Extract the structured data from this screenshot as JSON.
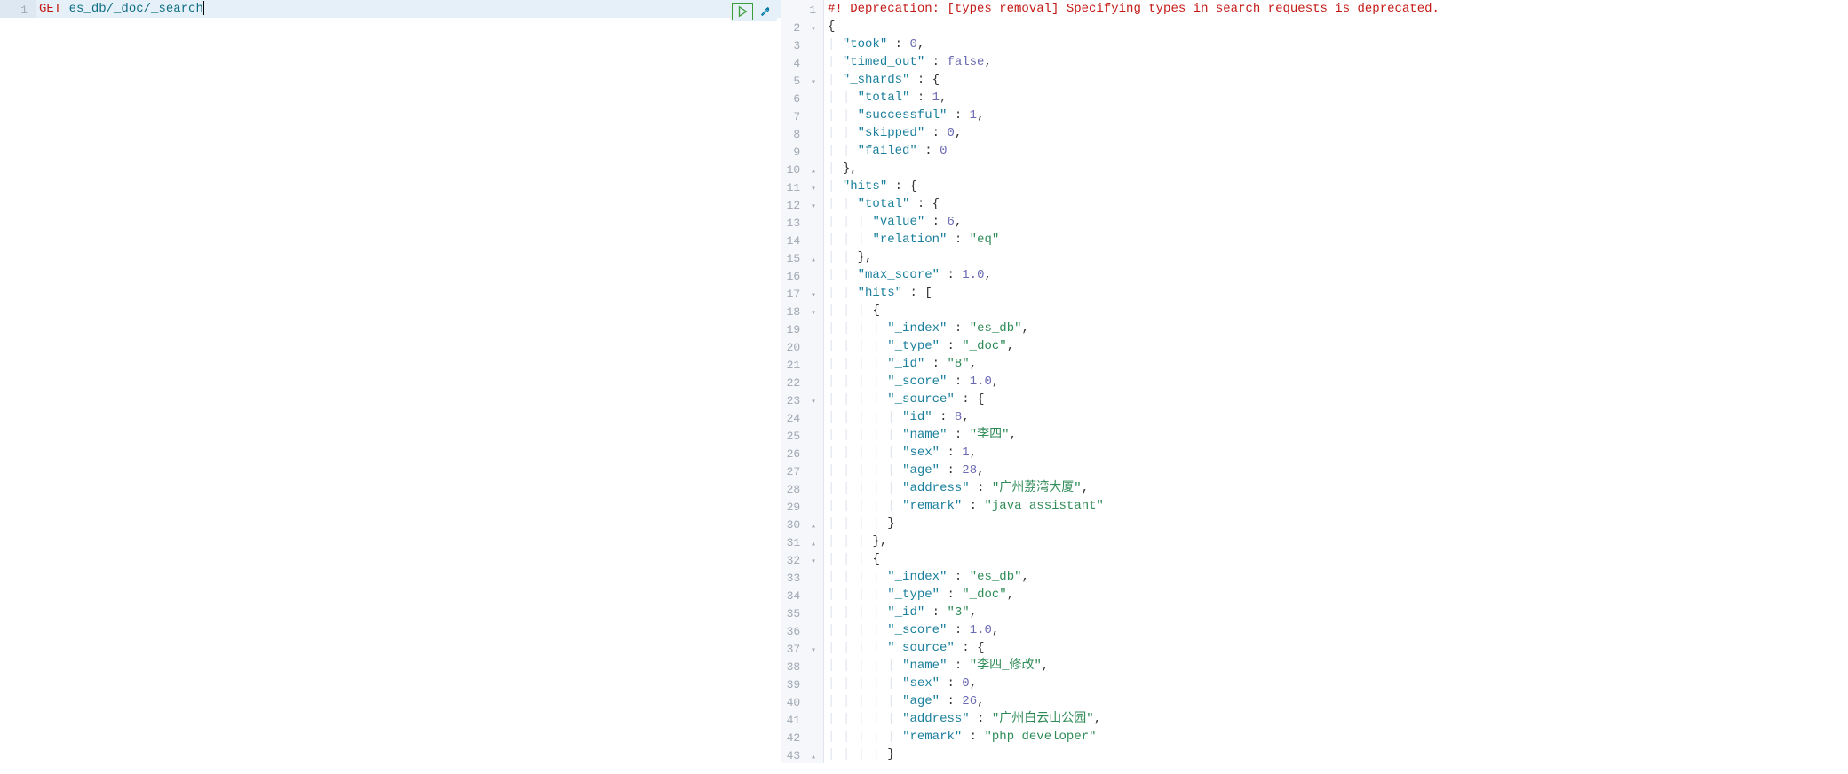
{
  "request": {
    "line_number": "1",
    "method": "GET",
    "path": "es_db/_doc/_search"
  },
  "actions": {
    "play": "play",
    "wrench": "wrench"
  },
  "response": {
    "deprecation_prefix": "#!",
    "deprecation_msg": "Deprecation: [types removal] Specifying types in search requests is deprecated.",
    "lines": [
      {
        "n": "1",
        "fold": "",
        "code": ""
      },
      {
        "n": "2",
        "fold": "▾",
        "indent": 0,
        "tokens": [
          {
            "t": "punct",
            "v": "{"
          }
        ]
      },
      {
        "n": "3",
        "fold": "",
        "indent": 1,
        "tokens": [
          {
            "t": "key",
            "v": "\"took\""
          },
          {
            "t": "punct",
            "v": " : "
          },
          {
            "t": "num",
            "v": "0"
          },
          {
            "t": "punct",
            "v": ","
          }
        ]
      },
      {
        "n": "4",
        "fold": "",
        "indent": 1,
        "tokens": [
          {
            "t": "key",
            "v": "\"timed_out\""
          },
          {
            "t": "punct",
            "v": " : "
          },
          {
            "t": "bool",
            "v": "false"
          },
          {
            "t": "punct",
            "v": ","
          }
        ]
      },
      {
        "n": "5",
        "fold": "▾",
        "indent": 1,
        "tokens": [
          {
            "t": "key",
            "v": "\"_shards\""
          },
          {
            "t": "punct",
            "v": " : {"
          }
        ]
      },
      {
        "n": "6",
        "fold": "",
        "indent": 2,
        "tokens": [
          {
            "t": "key",
            "v": "\"total\""
          },
          {
            "t": "punct",
            "v": " : "
          },
          {
            "t": "num",
            "v": "1"
          },
          {
            "t": "punct",
            "v": ","
          }
        ]
      },
      {
        "n": "7",
        "fold": "",
        "indent": 2,
        "tokens": [
          {
            "t": "key",
            "v": "\"successful\""
          },
          {
            "t": "punct",
            "v": " : "
          },
          {
            "t": "num",
            "v": "1"
          },
          {
            "t": "punct",
            "v": ","
          }
        ]
      },
      {
        "n": "8",
        "fold": "",
        "indent": 2,
        "tokens": [
          {
            "t": "key",
            "v": "\"skipped\""
          },
          {
            "t": "punct",
            "v": " : "
          },
          {
            "t": "num",
            "v": "0"
          },
          {
            "t": "punct",
            "v": ","
          }
        ]
      },
      {
        "n": "9",
        "fold": "",
        "indent": 2,
        "tokens": [
          {
            "t": "key",
            "v": "\"failed\""
          },
          {
            "t": "punct",
            "v": " : "
          },
          {
            "t": "num",
            "v": "0"
          }
        ]
      },
      {
        "n": "10",
        "fold": "▴",
        "indent": 1,
        "tokens": [
          {
            "t": "punct",
            "v": "},"
          }
        ]
      },
      {
        "n": "11",
        "fold": "▾",
        "indent": 1,
        "tokens": [
          {
            "t": "key",
            "v": "\"hits\""
          },
          {
            "t": "punct",
            "v": " : {"
          }
        ]
      },
      {
        "n": "12",
        "fold": "▾",
        "indent": 2,
        "tokens": [
          {
            "t": "key",
            "v": "\"total\""
          },
          {
            "t": "punct",
            "v": " : {"
          }
        ]
      },
      {
        "n": "13",
        "fold": "",
        "indent": 3,
        "tokens": [
          {
            "t": "key",
            "v": "\"value\""
          },
          {
            "t": "punct",
            "v": " : "
          },
          {
            "t": "num",
            "v": "6"
          },
          {
            "t": "punct",
            "v": ","
          }
        ]
      },
      {
        "n": "14",
        "fold": "",
        "indent": 3,
        "tokens": [
          {
            "t": "key",
            "v": "\"relation\""
          },
          {
            "t": "punct",
            "v": " : "
          },
          {
            "t": "str",
            "v": "\"eq\""
          }
        ]
      },
      {
        "n": "15",
        "fold": "▴",
        "indent": 2,
        "tokens": [
          {
            "t": "punct",
            "v": "},"
          }
        ]
      },
      {
        "n": "16",
        "fold": "",
        "indent": 2,
        "tokens": [
          {
            "t": "key",
            "v": "\"max_score\""
          },
          {
            "t": "punct",
            "v": " : "
          },
          {
            "t": "num",
            "v": "1.0"
          },
          {
            "t": "punct",
            "v": ","
          }
        ]
      },
      {
        "n": "17",
        "fold": "▾",
        "indent": 2,
        "tokens": [
          {
            "t": "key",
            "v": "\"hits\""
          },
          {
            "t": "punct",
            "v": " : ["
          }
        ]
      },
      {
        "n": "18",
        "fold": "▾",
        "indent": 3,
        "tokens": [
          {
            "t": "punct",
            "v": "{"
          }
        ]
      },
      {
        "n": "19",
        "fold": "",
        "indent": 4,
        "tokens": [
          {
            "t": "key",
            "v": "\"_index\""
          },
          {
            "t": "punct",
            "v": " : "
          },
          {
            "t": "str",
            "v": "\"es_db\""
          },
          {
            "t": "punct",
            "v": ","
          }
        ]
      },
      {
        "n": "20",
        "fold": "",
        "indent": 4,
        "tokens": [
          {
            "t": "key",
            "v": "\"_type\""
          },
          {
            "t": "punct",
            "v": " : "
          },
          {
            "t": "str",
            "v": "\"_doc\""
          },
          {
            "t": "punct",
            "v": ","
          }
        ]
      },
      {
        "n": "21",
        "fold": "",
        "indent": 4,
        "tokens": [
          {
            "t": "key",
            "v": "\"_id\""
          },
          {
            "t": "punct",
            "v": " : "
          },
          {
            "t": "str",
            "v": "\"8\""
          },
          {
            "t": "punct",
            "v": ","
          }
        ]
      },
      {
        "n": "22",
        "fold": "",
        "indent": 4,
        "tokens": [
          {
            "t": "key",
            "v": "\"_score\""
          },
          {
            "t": "punct",
            "v": " : "
          },
          {
            "t": "num",
            "v": "1.0"
          },
          {
            "t": "punct",
            "v": ","
          }
        ]
      },
      {
        "n": "23",
        "fold": "▾",
        "indent": 4,
        "tokens": [
          {
            "t": "key",
            "v": "\"_source\""
          },
          {
            "t": "punct",
            "v": " : {"
          }
        ]
      },
      {
        "n": "24",
        "fold": "",
        "indent": 5,
        "tokens": [
          {
            "t": "key",
            "v": "\"id\""
          },
          {
            "t": "punct",
            "v": " : "
          },
          {
            "t": "num",
            "v": "8"
          },
          {
            "t": "punct",
            "v": ","
          }
        ]
      },
      {
        "n": "25",
        "fold": "",
        "indent": 5,
        "tokens": [
          {
            "t": "key",
            "v": "\"name\""
          },
          {
            "t": "punct",
            "v": " : "
          },
          {
            "t": "str",
            "v": "\"李四\""
          },
          {
            "t": "punct",
            "v": ","
          }
        ]
      },
      {
        "n": "26",
        "fold": "",
        "indent": 5,
        "tokens": [
          {
            "t": "key",
            "v": "\"sex\""
          },
          {
            "t": "punct",
            "v": " : "
          },
          {
            "t": "num",
            "v": "1"
          },
          {
            "t": "punct",
            "v": ","
          }
        ]
      },
      {
        "n": "27",
        "fold": "",
        "indent": 5,
        "tokens": [
          {
            "t": "key",
            "v": "\"age\""
          },
          {
            "t": "punct",
            "v": " : "
          },
          {
            "t": "num",
            "v": "28"
          },
          {
            "t": "punct",
            "v": ","
          }
        ]
      },
      {
        "n": "28",
        "fold": "",
        "indent": 5,
        "tokens": [
          {
            "t": "key",
            "v": "\"address\""
          },
          {
            "t": "punct",
            "v": " : "
          },
          {
            "t": "str",
            "v": "\"广州荔湾大厦\""
          },
          {
            "t": "punct",
            "v": ","
          }
        ]
      },
      {
        "n": "29",
        "fold": "",
        "indent": 5,
        "tokens": [
          {
            "t": "key",
            "v": "\"remark\""
          },
          {
            "t": "punct",
            "v": " : "
          },
          {
            "t": "str",
            "v": "\"java assistant\""
          }
        ]
      },
      {
        "n": "30",
        "fold": "▴",
        "indent": 4,
        "tokens": [
          {
            "t": "punct",
            "v": "}"
          }
        ]
      },
      {
        "n": "31",
        "fold": "▴",
        "indent": 3,
        "tokens": [
          {
            "t": "punct",
            "v": "},"
          }
        ]
      },
      {
        "n": "32",
        "fold": "▾",
        "indent": 3,
        "tokens": [
          {
            "t": "punct",
            "v": "{"
          }
        ]
      },
      {
        "n": "33",
        "fold": "",
        "indent": 4,
        "tokens": [
          {
            "t": "key",
            "v": "\"_index\""
          },
          {
            "t": "punct",
            "v": " : "
          },
          {
            "t": "str",
            "v": "\"es_db\""
          },
          {
            "t": "punct",
            "v": ","
          }
        ]
      },
      {
        "n": "34",
        "fold": "",
        "indent": 4,
        "tokens": [
          {
            "t": "key",
            "v": "\"_type\""
          },
          {
            "t": "punct",
            "v": " : "
          },
          {
            "t": "str",
            "v": "\"_doc\""
          },
          {
            "t": "punct",
            "v": ","
          }
        ]
      },
      {
        "n": "35",
        "fold": "",
        "indent": 4,
        "tokens": [
          {
            "t": "key",
            "v": "\"_id\""
          },
          {
            "t": "punct",
            "v": " : "
          },
          {
            "t": "str",
            "v": "\"3\""
          },
          {
            "t": "punct",
            "v": ","
          }
        ]
      },
      {
        "n": "36",
        "fold": "",
        "indent": 4,
        "tokens": [
          {
            "t": "key",
            "v": "\"_score\""
          },
          {
            "t": "punct",
            "v": " : "
          },
          {
            "t": "num",
            "v": "1.0"
          },
          {
            "t": "punct",
            "v": ","
          }
        ]
      },
      {
        "n": "37",
        "fold": "▾",
        "indent": 4,
        "tokens": [
          {
            "t": "key",
            "v": "\"_source\""
          },
          {
            "t": "punct",
            "v": " : {"
          }
        ]
      },
      {
        "n": "38",
        "fold": "",
        "indent": 5,
        "tokens": [
          {
            "t": "key",
            "v": "\"name\""
          },
          {
            "t": "punct",
            "v": " : "
          },
          {
            "t": "str",
            "v": "\"李四_修改\""
          },
          {
            "t": "punct",
            "v": ","
          }
        ]
      },
      {
        "n": "39",
        "fold": "",
        "indent": 5,
        "tokens": [
          {
            "t": "key",
            "v": "\"sex\""
          },
          {
            "t": "punct",
            "v": " : "
          },
          {
            "t": "num",
            "v": "0"
          },
          {
            "t": "punct",
            "v": ","
          }
        ]
      },
      {
        "n": "40",
        "fold": "",
        "indent": 5,
        "tokens": [
          {
            "t": "key",
            "v": "\"age\""
          },
          {
            "t": "punct",
            "v": " : "
          },
          {
            "t": "num",
            "v": "26"
          },
          {
            "t": "punct",
            "v": ","
          }
        ]
      },
      {
        "n": "41",
        "fold": "",
        "indent": 5,
        "tokens": [
          {
            "t": "key",
            "v": "\"address\""
          },
          {
            "t": "punct",
            "v": " : "
          },
          {
            "t": "str",
            "v": "\"广州白云山公园\""
          },
          {
            "t": "punct",
            "v": ","
          }
        ]
      },
      {
        "n": "42",
        "fold": "",
        "indent": 5,
        "tokens": [
          {
            "t": "key",
            "v": "\"remark\""
          },
          {
            "t": "punct",
            "v": " : "
          },
          {
            "t": "str",
            "v": "\"php developer\""
          }
        ]
      },
      {
        "n": "43",
        "fold": "▴",
        "indent": 4,
        "tokens": [
          {
            "t": "punct",
            "v": "}"
          }
        ]
      }
    ]
  }
}
